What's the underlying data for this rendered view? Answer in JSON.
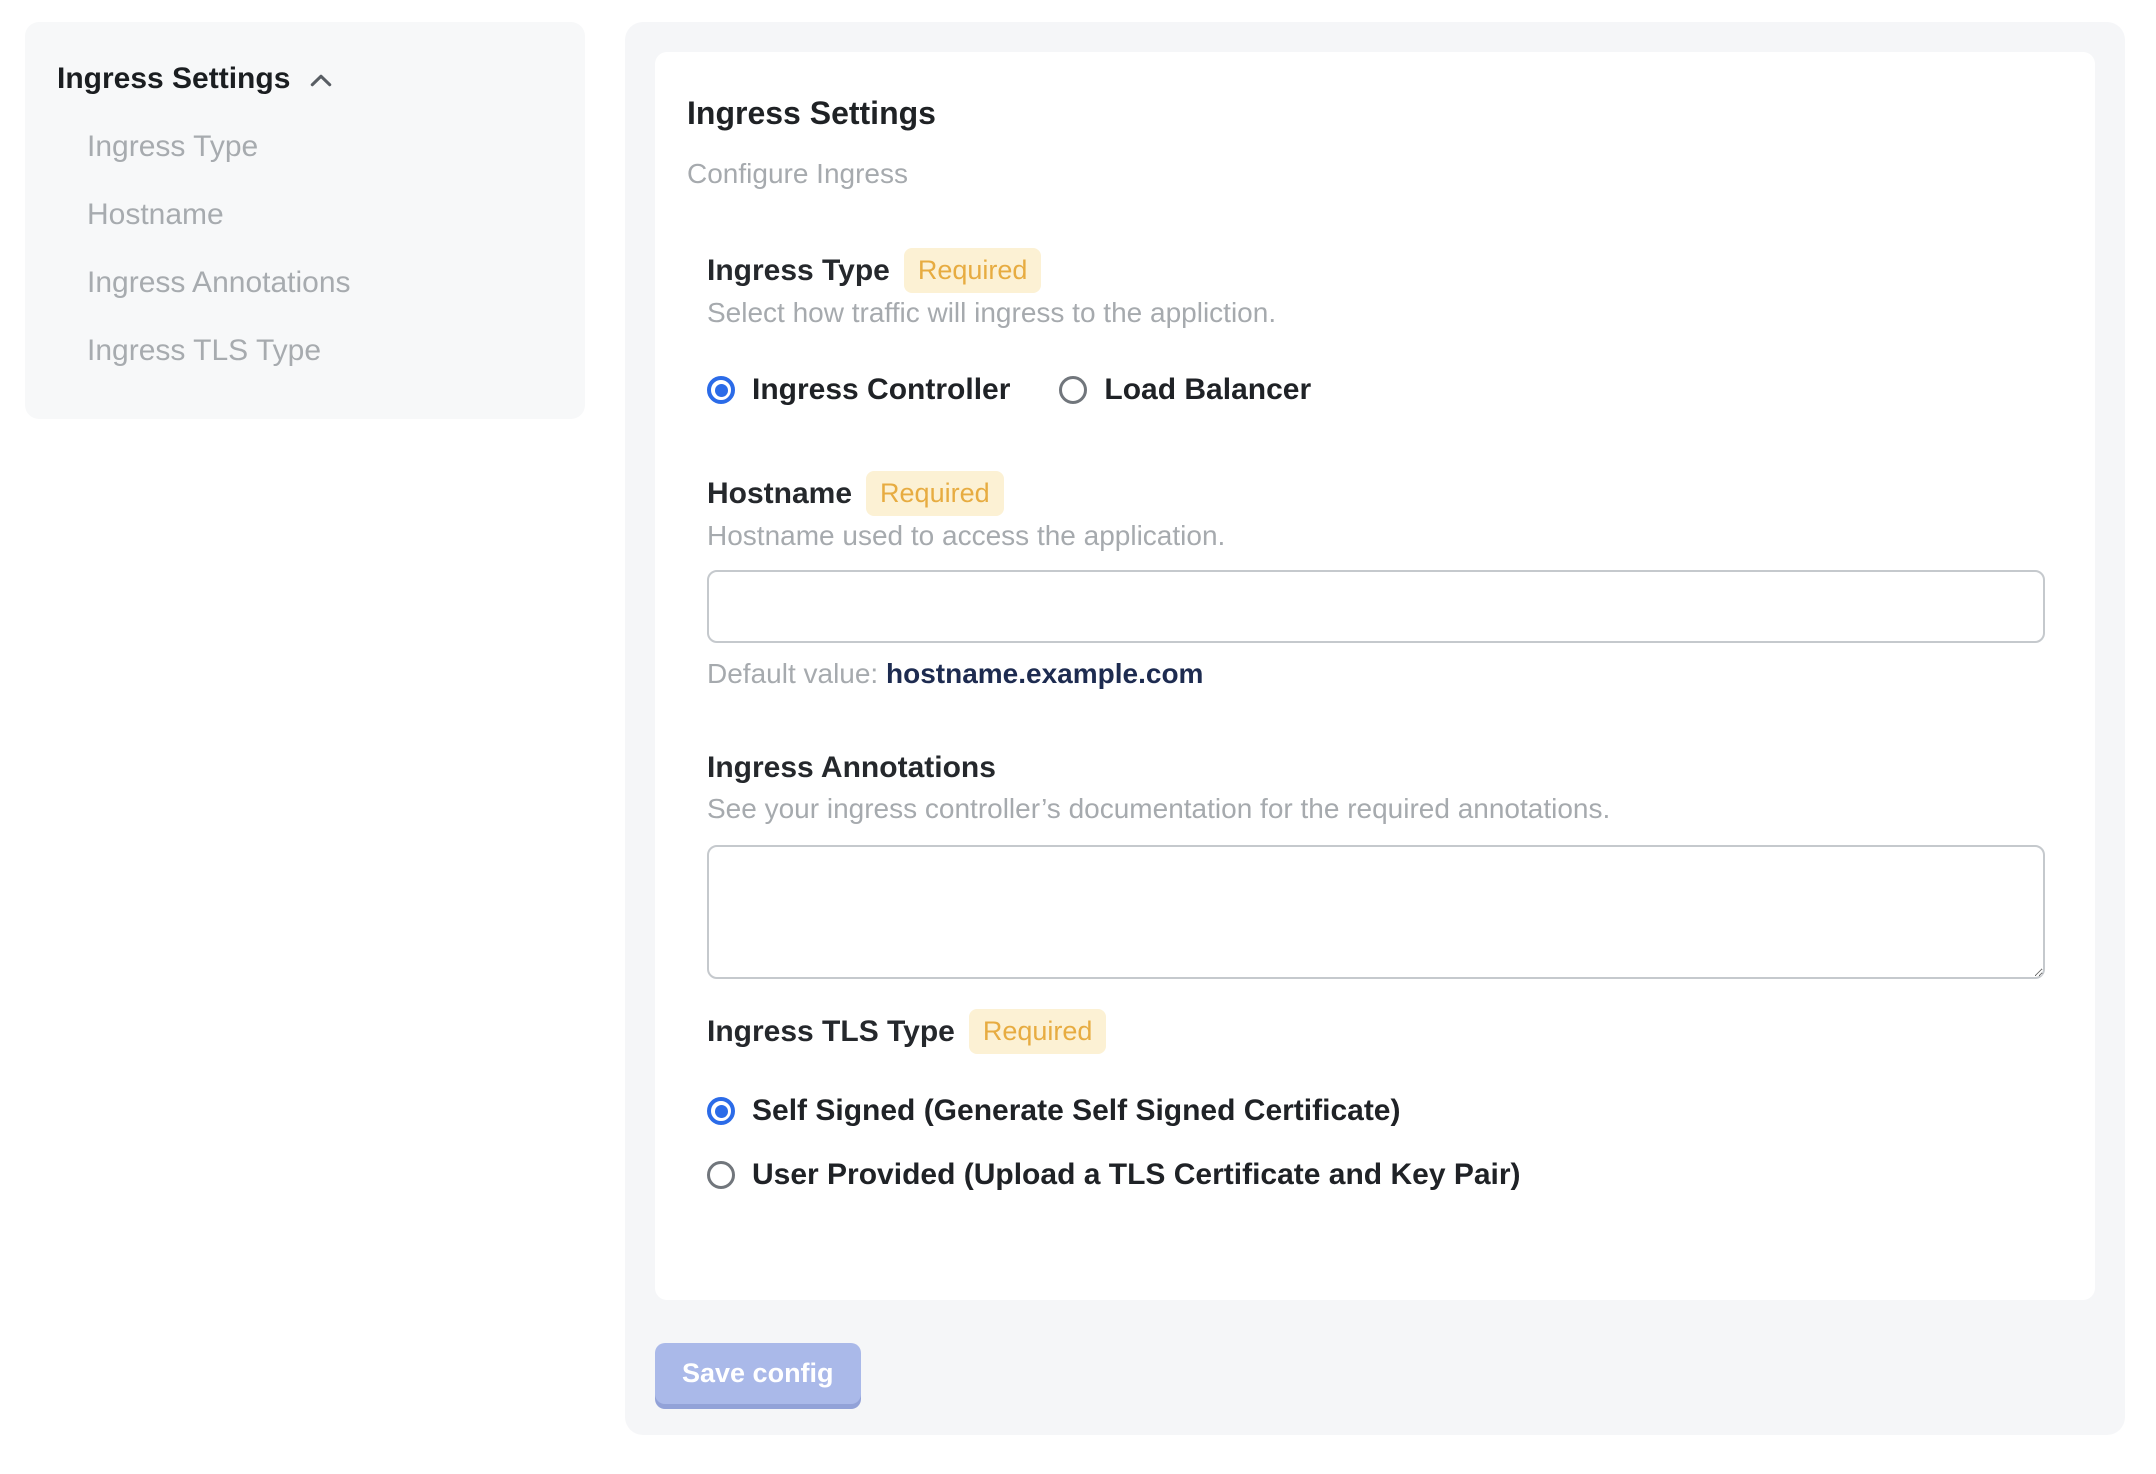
{
  "colors": {
    "accent_blue": "#2b6be8",
    "badge_bg": "#fcf1d4",
    "badge_text": "#e7ac41",
    "button_bg": "#aab9e9",
    "button_shadow": "#92a2d8",
    "default_value_navy": "#1d2b50",
    "sidebar_bg": "#f7f8f9",
    "panel_bg": "#f5f6f8"
  },
  "sidebar": {
    "title": "Ingress Settings",
    "items": [
      {
        "label": "Ingress Type"
      },
      {
        "label": "Hostname"
      },
      {
        "label": "Ingress Annotations"
      },
      {
        "label": "Ingress TLS Type"
      }
    ]
  },
  "panel": {
    "title": "Ingress Settings",
    "subtitle": "Configure Ingress",
    "sections": {
      "ingress_type": {
        "label": "Ingress Type",
        "required_badge": "Required",
        "description": "Select how traffic will ingress to the appliction.",
        "options": [
          {
            "label": "Ingress Controller",
            "selected": true
          },
          {
            "label": "Load Balancer",
            "selected": false
          }
        ]
      },
      "hostname": {
        "label": "Hostname",
        "required_badge": "Required",
        "description": "Hostname used to access the application.",
        "input_value": "",
        "default_prefix": "Default value: ",
        "default_value": "hostname.example.com"
      },
      "ingress_annotations": {
        "label": "Ingress Annotations",
        "description": "See your ingress controller’s documentation for the required annotations.",
        "textarea_value": ""
      },
      "ingress_tls_type": {
        "label": "Ingress TLS Type",
        "required_badge": "Required",
        "options": [
          {
            "label": "Self Signed (Generate Self Signed Certificate)",
            "selected": true
          },
          {
            "label": "User Provided (Upload a TLS Certificate and Key Pair)",
            "selected": false
          }
        ]
      }
    },
    "save_button_label": "Save config"
  }
}
